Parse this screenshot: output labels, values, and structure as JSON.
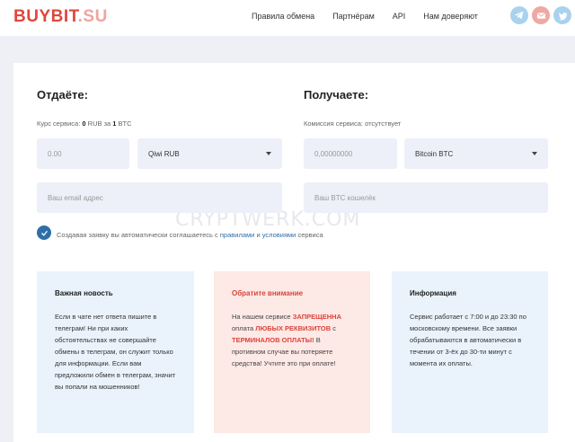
{
  "header": {
    "logo_part1": "BUYBIT",
    "logo_part2": ".SU",
    "nav": [
      "Правила обмена",
      "Партнёрам",
      "API",
      "Нам доверяют"
    ],
    "socials": [
      "telegram-icon",
      "mail-icon",
      "twitter-icon"
    ]
  },
  "give": {
    "title": "Отдаёте:",
    "rate_prefix": "Курс сервиса: ",
    "rate_value": "0",
    "rate_mid": " RUB за ",
    "rate_value2": "1",
    "rate_suffix": " BTC",
    "amount_placeholder": "0.00",
    "currency_selected": "Qiwi RUB",
    "email_placeholder": "Ваш email адрес"
  },
  "get": {
    "title": "Получаете:",
    "fee_text": "Комиссия сервиса: отсутствует",
    "amount_placeholder": "0,00000000",
    "currency_selected": "Bitcoin BTC",
    "wallet_placeholder": "Ваш BTC кошелёк"
  },
  "agreement": {
    "text1": "Создавая заявку вы автоматически соглашаетесь с ",
    "link1": "правилами",
    "text2": " и ",
    "link2": "условиями",
    "text3": " сервиса"
  },
  "watermark": "CRYPTWERK.COM",
  "boxes": {
    "news": {
      "title": "Важная новость",
      "body": "Если в чате нет ответа пишите в телеграм! Ни при каких обстоятельствах не совершайте обмены в телеграм, он служит только для информации. Если вам предложили обмен в телеграм, значит вы попали на мошенников!"
    },
    "attention": {
      "title": "Обратите внимание",
      "p1": "На нашем сервисе ",
      "b1": "ЗАПРЕЩЕННА",
      "p2": " оплата ",
      "b2": "ЛЮБЫХ РЕКВИЗИТОВ",
      "p3": " с ",
      "b3": "ТЕРМИНАЛОВ ОПЛАТЫ!",
      "p4": " В противном случае вы потеряете средства! Учтите это при оплате!"
    },
    "info": {
      "title": "Информация",
      "body": "Сервис работает с 7:00 и до 23:30 по московскому времени. Все заявки обрабатываются в автоматически в течении от 3-ёх до 30-ти минут с момента их оплаты."
    }
  },
  "colors": {
    "brand_red": "#e0463c",
    "accent_blue": "#2f6fa8",
    "field_bg": "#edf0f8"
  }
}
